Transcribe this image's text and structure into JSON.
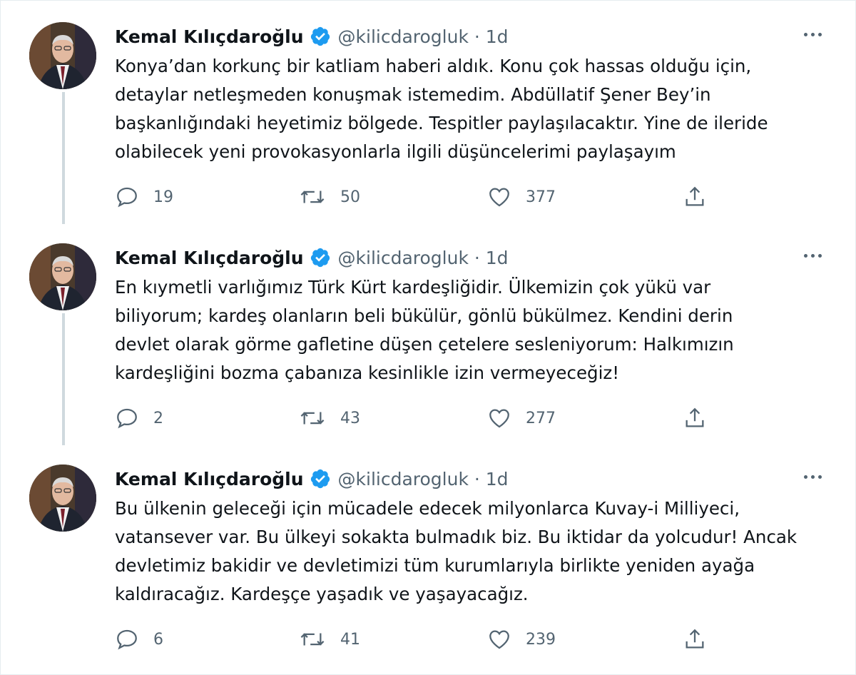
{
  "accent": "#1d9bf0",
  "tweets": [
    {
      "name": "Kemal Kılıçdaroğlu",
      "handle": "@kilicdarogluk · 1d",
      "text": "Konya’dan korkunç bir katliam haberi aldık. Konu çok hassas olduğu için,\ndetaylar netleşmeden konuşmak istemedim. Abdüllatif Şener Bey’in\nbaşkanlığındaki heyetimiz bölgede. Tespitler paylaşılacaktır. Yine de ileride\nolabilecek yeni provokasyonlarla ilgili düşüncelerimi paylaşayım",
      "replies": "19",
      "retweets": "50",
      "likes": "377"
    },
    {
      "name": "Kemal Kılıçdaroğlu",
      "handle": "@kilicdarogluk · 1d",
      "text": "En kıymetli varlığımız Türk Kürt kardeşliğidir. Ülkemizin çok yükü var\nbiliyorum; kardeş olanların beli bükülür, gönlü bükülmez. Kendini derin\ndevlet olarak görme gafletine düşen çetelere sesleniyorum: Halkımızın\nkardeşliğini bozma çabanıza kesinlikle izin vermeyeceğiz!",
      "replies": "2",
      "retweets": "43",
      "likes": "277"
    },
    {
      "name": "Kemal Kılıçdaroğlu",
      "handle": "@kilicdarogluk · 1d",
      "text": "Bu ülkenin geleceği için mücadele edecek milyonlarca Kuvay-i Milliyeci,\nvatansever var. Bu ülkeyi sokakta bulmadık biz. Bu iktidar da yolcudur! Ancak\ndevletimiz bakidir ve devletimizi tüm kurumlarıyla birlikte yeniden ayağa\nkaldıracağız. Kardeşçe yaşadık ve yaşayacağız.",
      "replies": "6",
      "retweets": "41",
      "likes": "239"
    }
  ]
}
